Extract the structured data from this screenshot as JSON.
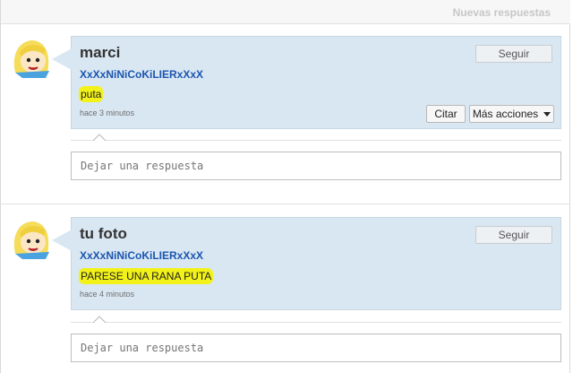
{
  "header": {
    "new_responses_label": "Nuevas respuestas"
  },
  "posts": [
    {
      "author": "marci",
      "follow_label": "Seguir",
      "username": "XxXxNiNiCoKiLIERxXxX",
      "message": "puta",
      "timestamp": "hace 3 minutos",
      "quote_label": "Citar",
      "more_actions_label": "Más acciones",
      "reply_placeholder": "Dejar una respuesta"
    },
    {
      "author": "tu foto",
      "follow_label": "Seguir",
      "username": "XxXxNiNiCoKiLIERxXxX",
      "message": "PARESE UNA RANA PUTA",
      "timestamp": "hace 4 minutos",
      "reply_placeholder": "Dejar una respuesta"
    }
  ],
  "colors": {
    "bubble": "#d9e7f2",
    "username_link": "#1b55b0",
    "highlight": "#f2f218"
  },
  "icons": {
    "avatar": "cartoon-blonde-character-avatar",
    "caret": "caret-down-icon"
  }
}
